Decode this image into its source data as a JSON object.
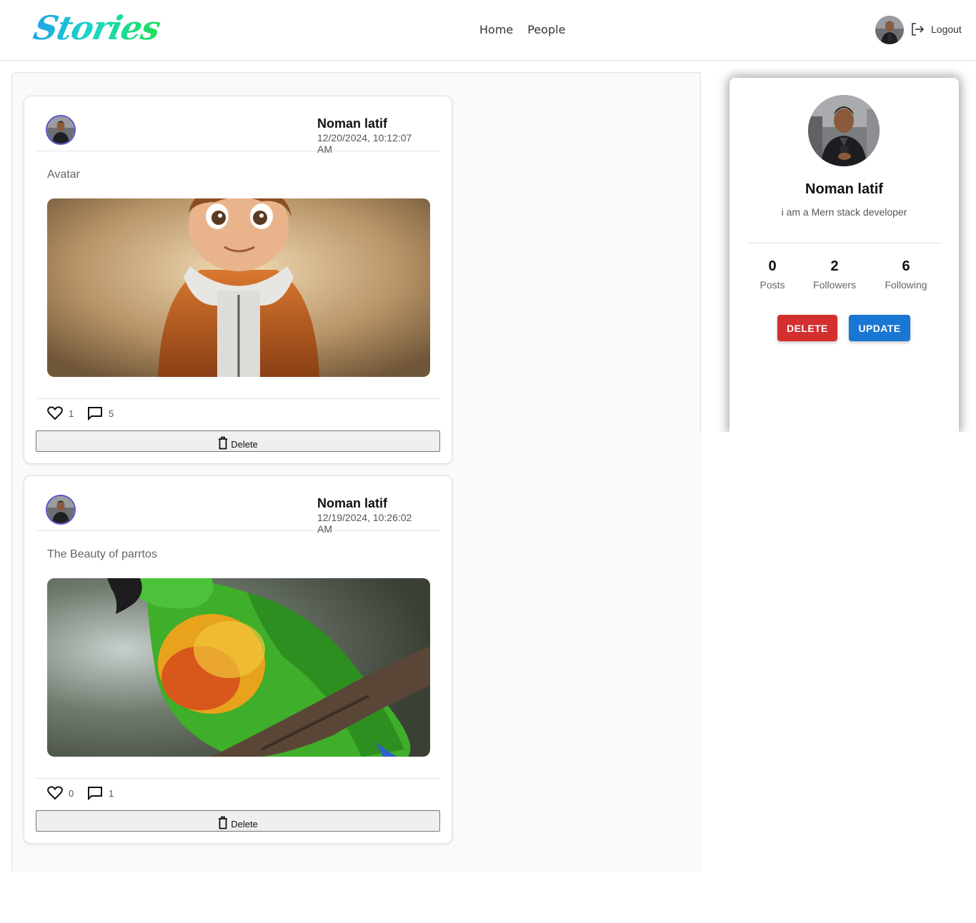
{
  "brand": {
    "logo_text": "Stories"
  },
  "nav": {
    "home": "Home",
    "people": "People",
    "logout": "Logout"
  },
  "posts": [
    {
      "author": "Noman latif",
      "date": "12/20/2024, 10:12:07 AM",
      "caption": "Avatar",
      "likes": "1",
      "comments": "5",
      "delete_label": "Delete"
    },
    {
      "author": "Noman latif",
      "date": "12/19/2024, 10:26:02 AM",
      "caption": "The Beauty of parrtos",
      "likes": "0",
      "comments": "1",
      "delete_label": "Delete"
    }
  ],
  "profile": {
    "name": "Noman latif",
    "bio": "i am a Mern stack developer",
    "stats": [
      {
        "value": "0",
        "label": "Posts"
      },
      {
        "value": "2",
        "label": "Followers"
      },
      {
        "value": "6",
        "label": "Following"
      }
    ],
    "delete_label": "DELETE",
    "update_label": "UPDATE"
  },
  "colors": {
    "delete": "#d32f2f",
    "update": "#1976d2",
    "avatar_ring": "#5b55c8"
  },
  "icons": {
    "logout": "logout-icon",
    "like": "heart-icon",
    "comment": "comment-icon",
    "trash": "trash-icon"
  }
}
